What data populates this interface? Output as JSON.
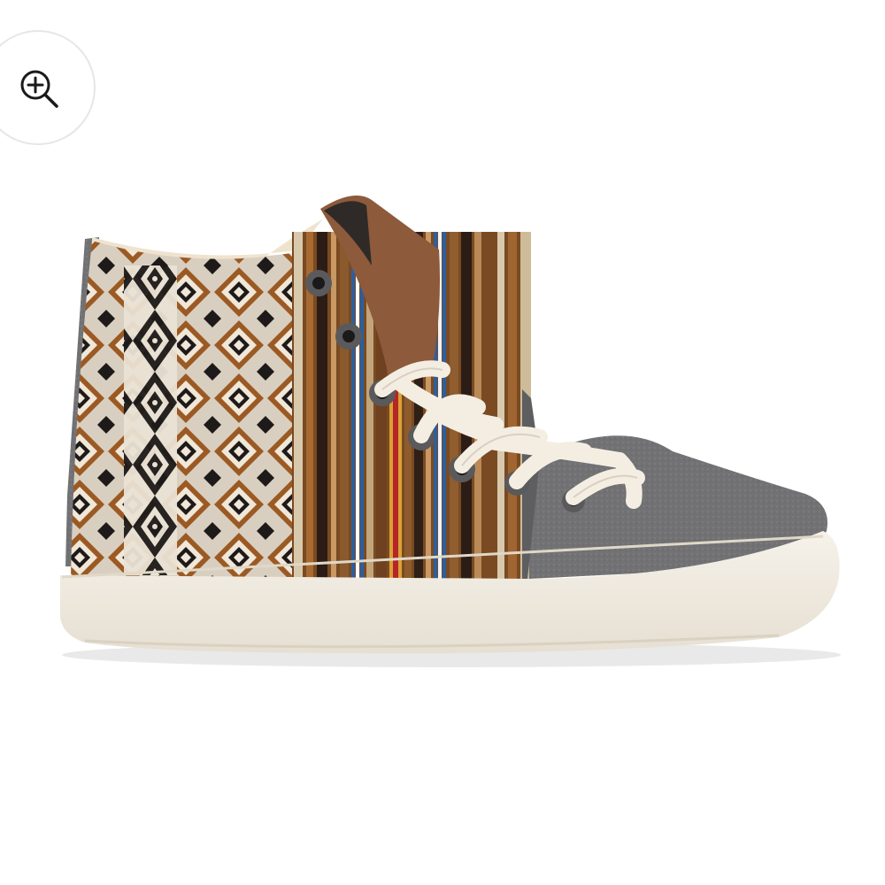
{
  "viewer": {
    "zoom_button": {
      "icon": "zoom-in-icon"
    },
    "product_image": {
      "subject": "high-top-sneaker-icon"
    }
  },
  "colors": {
    "background": "#ffffff",
    "sole": "#f1ece2",
    "felt": "#6f6f72",
    "rust": "#9b5a24",
    "black": "#1d1a19",
    "cream": "#efe5d4",
    "lace": "#f4eee2"
  }
}
